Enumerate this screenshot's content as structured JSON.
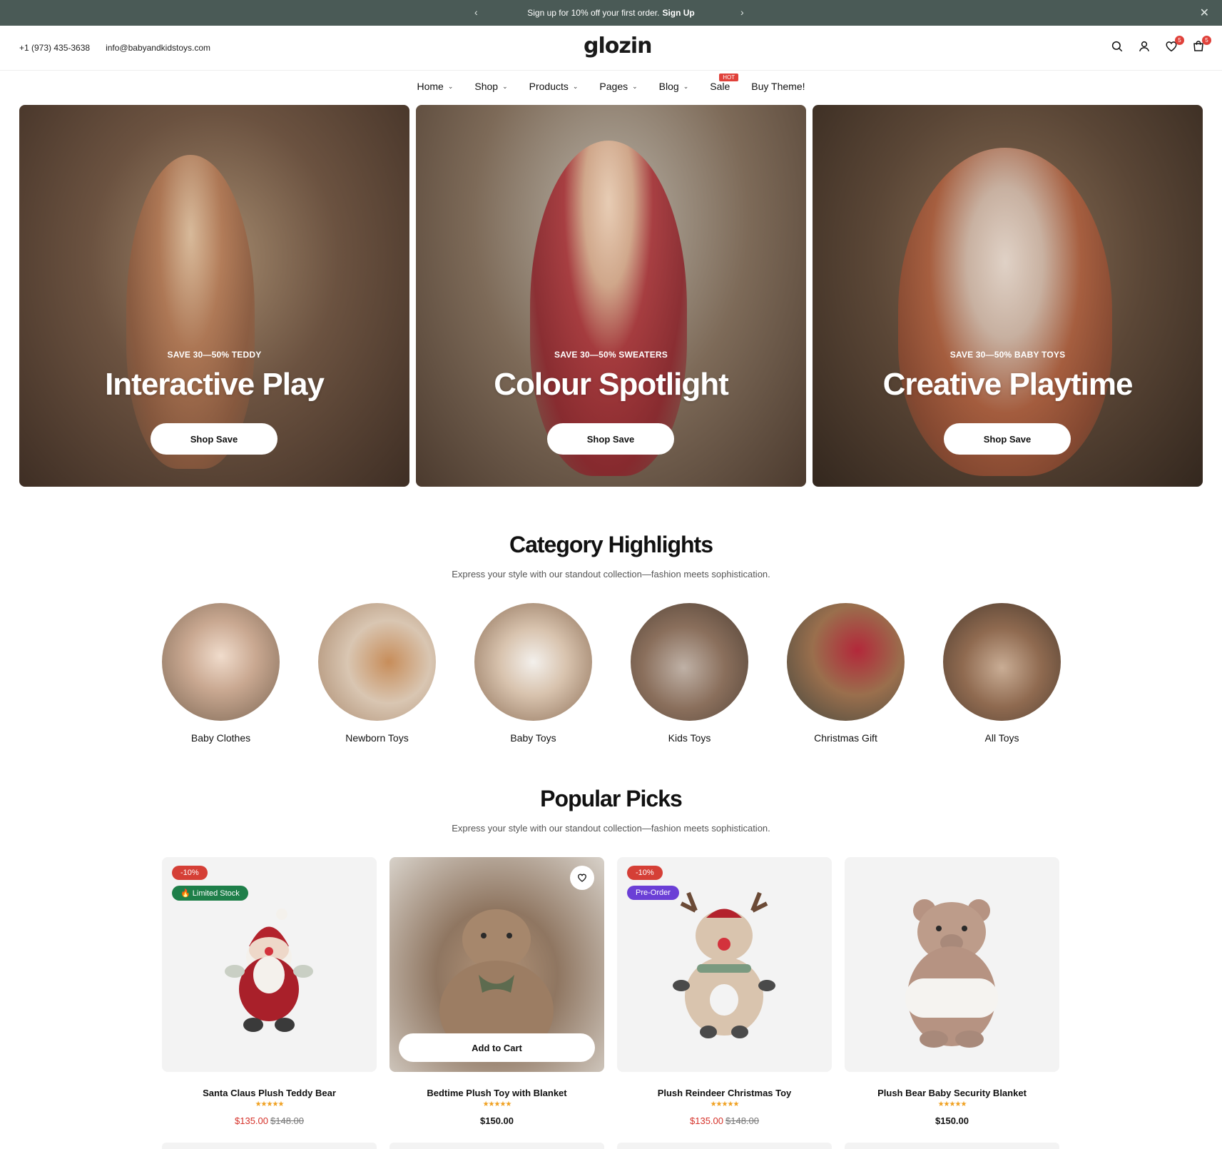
{
  "announcement": {
    "text": "Sign up for 10% off your first order.",
    "link": "Sign Up"
  },
  "header": {
    "phone": "+1 (973) 435-3638",
    "email": "info@babyandkidstoys.com",
    "logo": "glozin",
    "wishlist_count": "5",
    "cart_count": "5"
  },
  "nav": {
    "items": [
      {
        "label": "Home"
      },
      {
        "label": "Shop"
      },
      {
        "label": "Products"
      },
      {
        "label": "Pages"
      },
      {
        "label": "Blog"
      },
      {
        "label": "Sale"
      },
      {
        "label": "Buy Theme!"
      }
    ],
    "hot_badge": "HOT"
  },
  "hero": [
    {
      "label": "SAVE 30—50% TEDDY",
      "title": "Interactive Play",
      "button": "Shop Save"
    },
    {
      "label": "SAVE 30—50% SWEATERS",
      "title": "Colour Spotlight",
      "button": "Shop Save"
    },
    {
      "label": "SAVE 30—50% BABY TOYS",
      "title": "Creative Playtime",
      "button": "Shop Save"
    }
  ],
  "categories": {
    "title": "Category Highlights",
    "subtitle": "Express your style with our standout collection—fashion meets sophistication.",
    "items": [
      {
        "name": "Baby Clothes"
      },
      {
        "name": "Newborn Toys"
      },
      {
        "name": "Baby Toys"
      },
      {
        "name": "Kids Toys"
      },
      {
        "name": "Christmas Gift"
      },
      {
        "name": "All Toys"
      }
    ]
  },
  "popular": {
    "title": "Popular Picks",
    "subtitle": "Express your style with our standout collection—fashion meets sophistication.",
    "add_to_cart": "Add to Cart",
    "products": [
      {
        "name": "Santa Claus Plush Teddy Bear",
        "price": "$135.00",
        "old_price": "$148.00",
        "discount": "-10%",
        "tag": "🔥 Limited Stock",
        "rating": "★★★★★"
      },
      {
        "name": "Bedtime Plush Toy with Blanket",
        "price": "$150.00",
        "rating": "★★★★★"
      },
      {
        "name": "Plush Reindeer Christmas Toy",
        "price": "$135.00",
        "old_price": "$148.00",
        "discount": "-10%",
        "tag": "Pre-Order",
        "rating": "★★★★★"
      },
      {
        "name": "Plush Bear Baby Security Blanket",
        "price": "$150.00",
        "rating": "★★★★★"
      }
    ]
  },
  "colors": {
    "announcement_bg": "#4a5a56",
    "sale_red": "#d53028",
    "badge_red": "#e0413a",
    "stock_green": "#1e7f49",
    "preorder_purple": "#6b3fd6",
    "star_gold": "#f0a020"
  }
}
